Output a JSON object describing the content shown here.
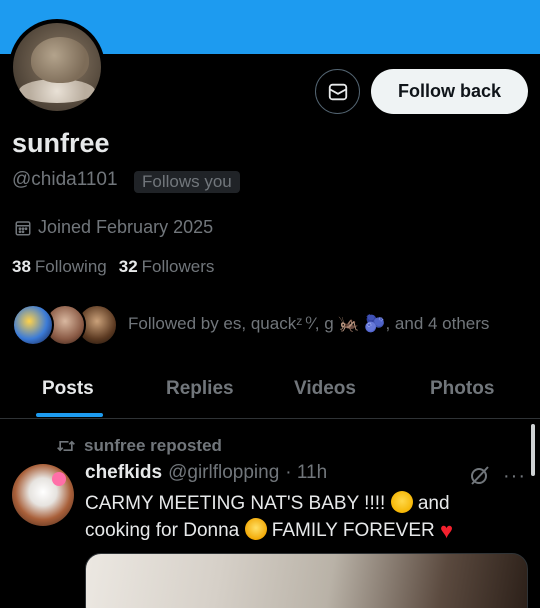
{
  "profile": {
    "name": "sunfree",
    "handle": "@chida1101",
    "follows_you_badge": "Follows you",
    "joined": "Joined February 2025",
    "following_count": "38",
    "following_label": "Following",
    "followers_count": "32",
    "followers_label": "Followers",
    "followed_by": "Followed by es, quackᶻ ⁰⁄, g 🦗 🫐, and 4 others"
  },
  "actions": {
    "follow_back_label": "Follow back",
    "message_icon": "envelope-icon"
  },
  "tabs": [
    {
      "label": "Posts",
      "active": true
    },
    {
      "label": "Replies",
      "active": false
    },
    {
      "label": "Videos",
      "active": false
    },
    {
      "label": "Photos",
      "active": false
    }
  ],
  "post": {
    "repost_label": "sunfree reposted",
    "author_name": "chefkids",
    "author_handle": "@girlflopping",
    "time": "· 11h",
    "text_part1": "CARMY MEETING NAT'S BABY !!!! ",
    "text_part2": " and cooking for Donna ",
    "text_part3": " FAMILY FOREVER "
  },
  "colors": {
    "banner": "#1d9bf0",
    "accent": "#1d9bf0",
    "background": "#000000",
    "muted_text": "#71767b"
  }
}
